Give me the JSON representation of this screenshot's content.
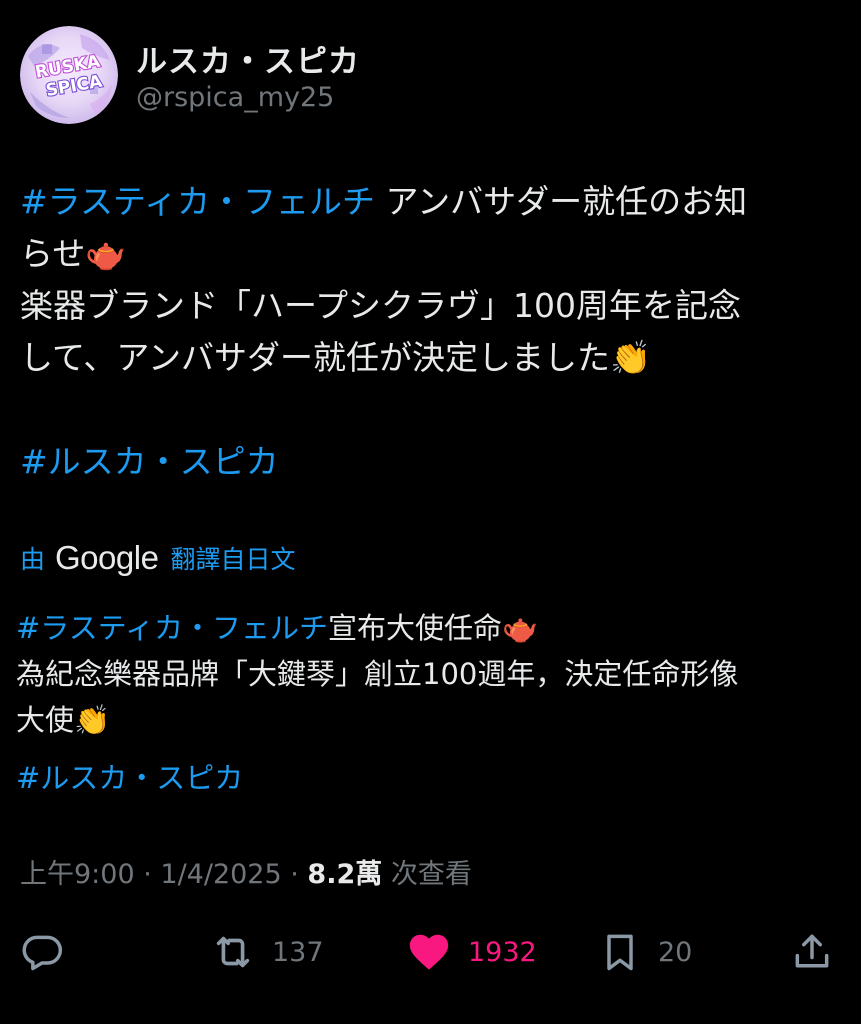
{
  "author": {
    "display_name": "ルスカ・スピカ",
    "handle": "@rspica_my25",
    "avatar_text_line1": "RUSKA",
    "avatar_text_line2": "SPICA"
  },
  "post": {
    "line1_hashtag": "#ラスティカ・フェルチ",
    "line1_text": " アンバサダー就任のお知",
    "line2_text": "らせ",
    "line3_text": "楽器ブランド「ハープシクラヴ」100周年を記念",
    "line4_text": "して、アンバサダー就任が決定しました",
    "hashtag2": "#ルスカ・スピカ",
    "emoji_teapot": "🫖",
    "emoji_clap": "👏"
  },
  "translation": {
    "by_label": "由",
    "provider": "Google",
    "from_label": "翻譯自日文",
    "line1_hashtag": "#ラスティカ・フェルチ",
    "line1_text": "宣布大使任命",
    "line2_text": "為紀念樂器品牌「大鍵琴」創立100週年，決定任命形像",
    "line3_text": "大使",
    "hashtag2": "#ルスカ・スピカ"
  },
  "meta": {
    "time": "上午9:00",
    "sep1": " · ",
    "date": "1/4/2025",
    "sep2": " · ",
    "views_count": "8.2萬",
    "views_label": " 次查看"
  },
  "actions": {
    "reply_icon": "reply-icon",
    "retweet_icon": "retweet-icon",
    "retweet_count": "137",
    "like_icon": "heart-icon",
    "like_count": "1932",
    "bookmark_icon": "bookmark-icon",
    "bookmark_count": "20",
    "share_icon": "share-icon"
  },
  "colors": {
    "background": "#000000",
    "text": "#e7e9ea",
    "secondary": "#71767b",
    "link": "#1d9bf0",
    "like": "#f91880"
  }
}
